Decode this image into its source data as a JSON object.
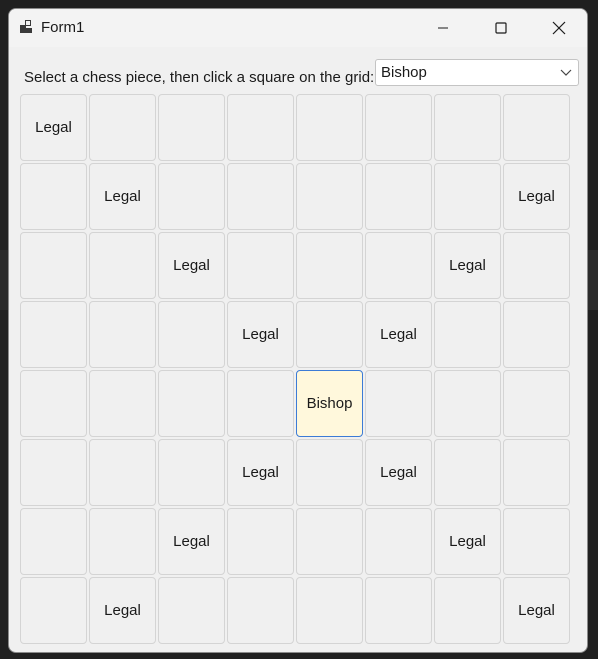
{
  "window": {
    "title": "Form1"
  },
  "prompt": "Select a chess piece, then click a square on the grid:",
  "piece_select": {
    "selected": "Bishop"
  },
  "board": {
    "rows": 8,
    "cols": 8,
    "piece_position": [
      4,
      4
    ],
    "cells": [
      [
        "Legal",
        "",
        "",
        "",
        "",
        "",
        "",
        ""
      ],
      [
        "",
        "Legal",
        "",
        "",
        "",
        "",
        "",
        "Legal"
      ],
      [
        "",
        "",
        "Legal",
        "",
        "",
        "",
        "Legal",
        ""
      ],
      [
        "",
        "",
        "",
        "Legal",
        "",
        "Legal",
        "",
        ""
      ],
      [
        "",
        "",
        "",
        "",
        "Bishop",
        "",
        "",
        ""
      ],
      [
        "",
        "",
        "",
        "Legal",
        "",
        "Legal",
        "",
        ""
      ],
      [
        "",
        "",
        "Legal",
        "",
        "",
        "",
        "Legal",
        ""
      ],
      [
        "",
        "Legal",
        "",
        "",
        "",
        "",
        "",
        "Legal"
      ]
    ]
  },
  "colors": {
    "piece_cell_bg": "#fff8dc",
    "piece_cell_border": "#3c7bd6",
    "cell_bg": "#f0f0f0"
  },
  "icons": {
    "app": "app-icon",
    "minimize": "minimize-icon",
    "maximize": "maximize-icon",
    "close": "close-icon",
    "dropdown": "chevron-down-icon"
  }
}
